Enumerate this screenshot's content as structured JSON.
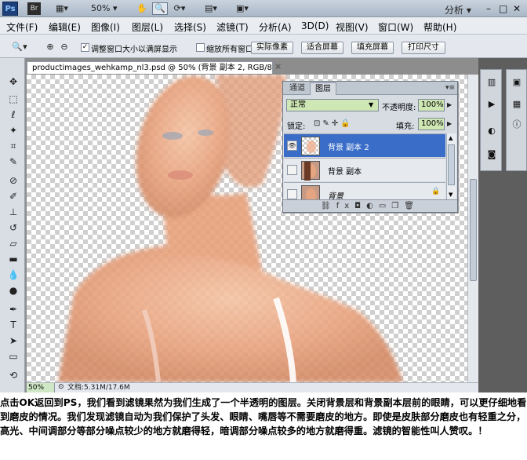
{
  "appbar": {
    "ps_logo": "Ps",
    "br_logo": "Br",
    "zoom_value": "50%",
    "workspace_label": "分析 ▾",
    "icons": [
      "bridge-icon",
      "screen-mode-icon",
      "hand-icon",
      "zoom-icon",
      "rotate-view-icon",
      "arrange-icon",
      "screen-icon"
    ],
    "window_buttons": {
      "minimize": "–",
      "maximize": "□",
      "close": "✕"
    }
  },
  "menubar": {
    "items": [
      "文件(F)",
      "编辑(E)",
      "图像(I)",
      "图层(L)",
      "选择(S)",
      "滤镜(T)",
      "分析(A)",
      "3D(D)",
      "视图(V)",
      "窗口(W)",
      "帮助(H)"
    ]
  },
  "options": {
    "resize_windows_label": "调整窗口大小以满屏显示",
    "zoom_all_label": "缩放所有窗口",
    "buttons": [
      "实际像素",
      "适合屏幕",
      "填充屏幕",
      "打印尺寸"
    ]
  },
  "document": {
    "tab_title": "productimages_wehkamp_nl3.psd @ 50% (背景 副本 2, RGB/8) *",
    "tab_close": "×",
    "zoom": "50%",
    "doc_size": "文档:5.31M/17.6M"
  },
  "layers_panel": {
    "tabs": [
      "通道",
      "图层"
    ],
    "active_tab": "图层",
    "blend_mode": "正常",
    "opacity_label": "不透明度:",
    "opacity": "100%",
    "lock_label": "锁定:",
    "fill_label": "填充:",
    "fill": "100%",
    "layers": [
      {
        "name": "背景 副本 2",
        "visible": true,
        "selected": true
      },
      {
        "name": "背景 副本",
        "visible": false,
        "selected": false
      },
      {
        "name": "背景",
        "visible": false,
        "selected": false,
        "locked": true
      }
    ],
    "footer_icons": [
      "link-icon",
      "fx-icon",
      "mask-icon",
      "adjustment-icon",
      "group-icon",
      "new-layer-icon",
      "trash-icon"
    ]
  },
  "caption": "点击OK返回到PS，我们看到滤镜果然为我们生成了一个半透明的图层。关闭背景层和背景副本层前的眼睛，可以更仔细地看到磨皮的情况。我们发现滤镜自动为我们保护了头发、眼睛、嘴唇等不需要磨皮的地方。即使是皮肤部分磨皮也有轻重之分，高光、中间调部分等部分噪点较少的地方就磨得轻，暗调部分噪点较多的地方就磨得重。滤镜的智能性叫人赞叹。！",
  "colors": {
    "selected_layer": "#3a6dc8",
    "field_green": "#cfe7b4",
    "skin": "#e9a47f"
  }
}
